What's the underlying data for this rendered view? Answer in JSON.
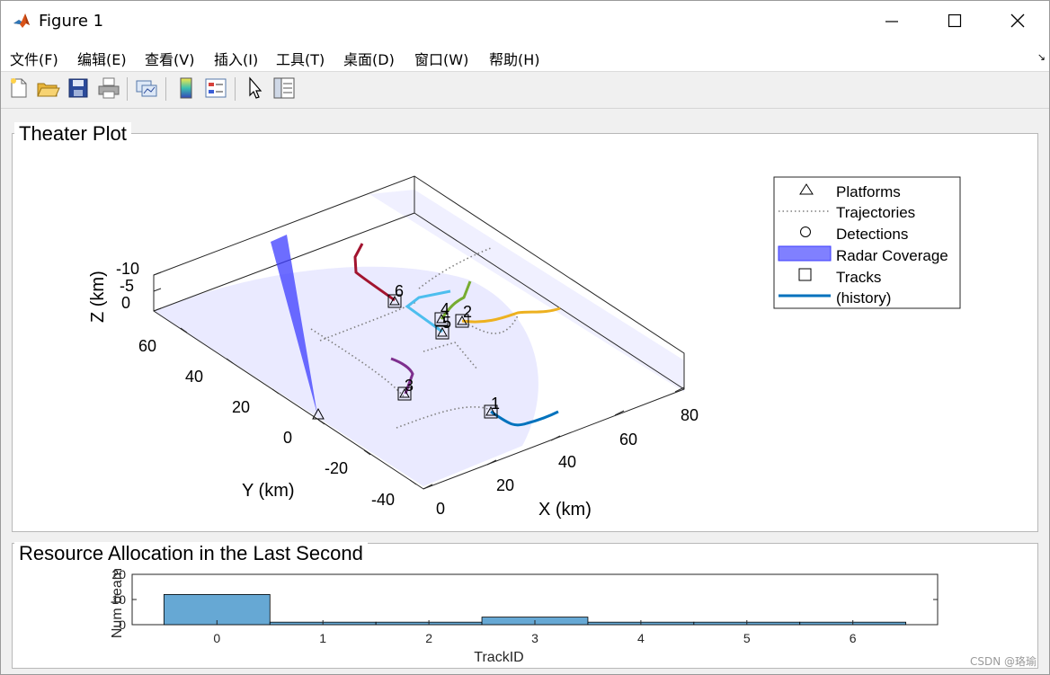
{
  "window": {
    "title": "Figure 1",
    "controls": {
      "minimize": "minimize",
      "maximize": "maximize",
      "close": "close"
    }
  },
  "menubar": {
    "items": [
      {
        "label": "文件(F)",
        "name": "file"
      },
      {
        "label": "编辑(E)",
        "name": "edit"
      },
      {
        "label": "查看(V)",
        "name": "view"
      },
      {
        "label": "插入(I)",
        "name": "insert"
      },
      {
        "label": "工具(T)",
        "name": "tools"
      },
      {
        "label": "桌面(D)",
        "name": "desktop"
      },
      {
        "label": "窗口(W)",
        "name": "window"
      },
      {
        "label": "帮助(H)",
        "name": "help"
      }
    ]
  },
  "toolbar": {
    "buttons": [
      "new-figure-icon",
      "open-folder-icon",
      "save-icon",
      "print-icon",
      "link-plot-icon",
      "colorbar-icon",
      "legend-icon",
      "pointer-icon",
      "property-inspector-icon"
    ]
  },
  "theater_panel": {
    "title": "Theater Plot",
    "legend": [
      {
        "label": "Platforms",
        "marker": "triangle"
      },
      {
        "label": "Trajectories",
        "marker": "dotted-line"
      },
      {
        "label": "Detections",
        "marker": "circle"
      },
      {
        "label": "Radar Coverage",
        "marker": "patch"
      },
      {
        "label": "Tracks",
        "marker": "square"
      },
      {
        "label": "(history)",
        "marker": "line"
      }
    ],
    "axes": {
      "xlabel": "X (km)",
      "ylabel": "Y (km)",
      "zlabel": "Z (km)",
      "xticks": [
        "0",
        "20",
        "40",
        "60",
        "80"
      ],
      "yticks": [
        "-40",
        "-20",
        "0",
        "20",
        "40",
        "60"
      ],
      "zticks": [
        "-10",
        "-5",
        "0"
      ]
    },
    "track_labels": [
      "1",
      "2",
      "3",
      "4",
      "5",
      "6"
    ]
  },
  "resource_panel": {
    "title": "Resource Allocation in the Last Second"
  },
  "chart_data": {
    "type": "bar",
    "title": "",
    "xlabel": "TrackID",
    "ylabel": "Num beam",
    "categories": [
      "0",
      "1",
      "2",
      "3",
      "4",
      "5",
      "6"
    ],
    "values": [
      12,
      1,
      1,
      3,
      1,
      1,
      1
    ],
    "yticks": [
      "0",
      "10",
      "20"
    ],
    "ylim": [
      0,
      20
    ],
    "bar_color": "#66a8d4"
  },
  "colors": {
    "radar_beam": "#3c3cff",
    "coverage": "#e6e6ff",
    "track_history": [
      "#0072bd",
      "#edb120",
      "#7e2f8e",
      "#77ac30",
      "#4dbeee",
      "#a2142f"
    ]
  },
  "watermark": "CSDN @珞瑜"
}
